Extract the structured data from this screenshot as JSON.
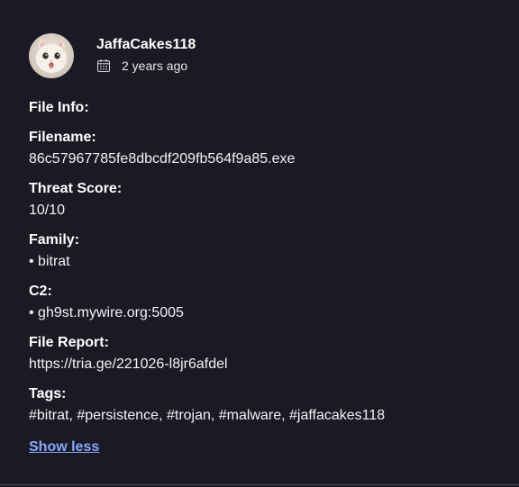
{
  "post": {
    "username": "JaffaCakes118",
    "time_ago": "2 years ago",
    "avatar_icon": "cat-avatar",
    "calendar_icon": "calendar-icon"
  },
  "file_info": {
    "heading": "File Info:",
    "filename_label": "Filename:",
    "filename_value": "86c57967785fe8dbcdf209fb564f9a85.exe",
    "threat_label": "Threat Score:",
    "threat_value": "10/10",
    "family_label": "Family:",
    "family_value": "• bitrat",
    "c2_label": "C2:",
    "c2_value": "• gh9st.mywire.org:5005",
    "report_label": "File Report:",
    "report_value": "https://tria.ge/221026-l8jr6afdel",
    "tags_label": "Tags:",
    "tags_value": "#bitrat, #persistence, #trojan, #malware, #jaffacakes118"
  },
  "actions": {
    "show_less": "Show less"
  },
  "colors": {
    "background": "#1b1a24",
    "text": "#f2f2f5",
    "link": "#8aa7ff"
  }
}
